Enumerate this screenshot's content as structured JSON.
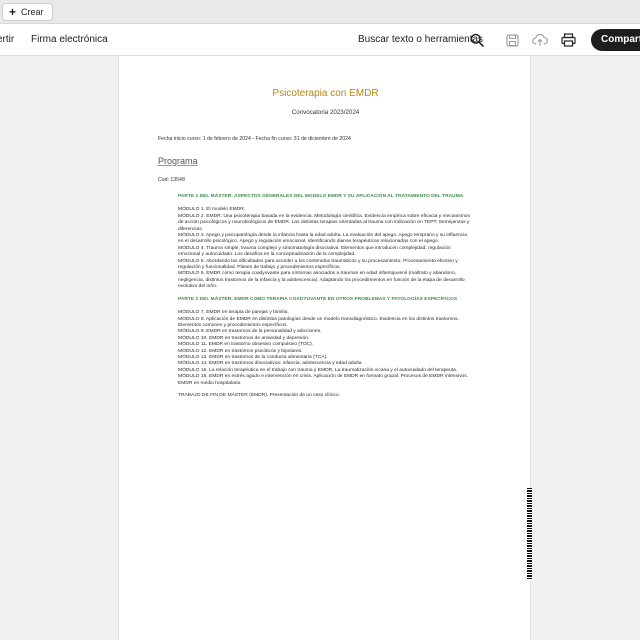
{
  "topbar": {
    "create_label": "Crear"
  },
  "toolbar": {
    "convert_label": "ertir",
    "sign_label": "Firma electrónica",
    "search_label": "Buscar texto o herramientas",
    "share_label": "Compartir"
  },
  "icons": [
    "search-icon",
    "save-icon",
    "upload-icon",
    "print-icon",
    "plus-icon"
  ],
  "colors": {
    "title": "#b5880f",
    "part_heading": "#3f8b4b",
    "share_bg": "#1e1e1e"
  },
  "document": {
    "title": "Psicoterapia con EMDR",
    "subtitle": "Convocatoria 2023/2024",
    "dates": "Fecha inicio curso: 1 de febrero de 2024 - Fecha fin curso: 31 de diciembre de 2024",
    "programa": "Programa",
    "code": "Cod: 13548",
    "part1_heading": "PARTE 1 DEL MÁSTER: ASPECTOS GENERALES DEL MODELO EMDR Y SU APLICACIÓN AL TRATAMIENTO DEL TRAUMA",
    "part1_modules": [
      "MÓDULO 1. El modelo EMDR.",
      "MÓDULO 2. EMDR: Una psicoterapia basada en la evidencia. Metodología científica. Evidencia empírica sobre eficacia y mecanismos de acción psicológicos y neurobiológicos de EMDR. Las distintas terapias orientadas al trauma con indicación en TEPT: Semejanzas y diferencias.",
      "MÓDULO 3. Apego y psicopatología desde la infancia hasta la edad adulta. La evaluación del apego. Apego temprano y su influencia en el desarrollo psicológico. Apego y regulación emocional. Identificando dianas terapéuticas relacionadas con el apego.",
      "MÓDULO 4. Trauma simple, trauma complejo y sintomatología disociativa. Elementos que introducen complejidad: regulación emocional y autocuidado. Los desafíos en la conceptualización de la complejidad.",
      "MÓDULO 5. Abordando las dificultades para acceder a los contenidos traumáticos y su procesamiento. Procesamiento efectivo y regulación y funcionalidad. Planes de trabajo y procedimientos específicos.",
      "MÓDULO 6. EMDR como terapia coadyuvante para síntomas asociados a traumas en edad infantojuvenil (maltrato y abandono, negligencia, distintos trastornos de la infancia y la adolescencia). Adaptando los procedimientos en función de la etapa de desarrollo evolutivo del niño."
    ],
    "part2_heading": "PARTE 2 DEL MÁSTER: EMDR COMO TERAPIA COADYUVANTE EN OTROS PROBLEMAS Y PATOLOGÍAS ESPECÍFICOS",
    "part2_modules": [
      "MÓDULO 7. EMDR en terapia de parejas y familia.",
      "MÓDULO 8. Aplicación de EMDR en distintas patologías desde un modelo transdiagnóstico. Evidencia en los distintos trastornos. Elementos comunes y procedimientos específicos.",
      "MÓDULO 9. EMDR en trastornos de la personalidad y adicciones.",
      "MÓDULO 10. EMDR en trastornos de ansiedad y depresión.",
      "MÓDULO 11. EMDR en trastorno obsesivo compulsivo (TOC).",
      "MÓDULO 12. EMDR en trastornos psicóticos y bipolares.",
      "MÓDULO 13. EMDR en trastornos de la conducta alimentaria (TCA).",
      "MÓDULO 14. EMDR en trastornos disociativos: infancia, adolescencia y edad adulta",
      "MÓDULO 15. La relación terapéutica en el trabajo con trauma y EMDR. La traumatización vicaria y el autocuidado del terapeuta.",
      "MÓDULO 16. EMDR en estrés agudo e intervención en crisis. Aplicación de EMDR en formato grupal. Procesos de EMDR intensivos. EMDR en medio hospitalario."
    ],
    "tfm": "TRABAJO DE FIN DE MÁSTER (EMDR). Presentación de un caso clínico."
  }
}
